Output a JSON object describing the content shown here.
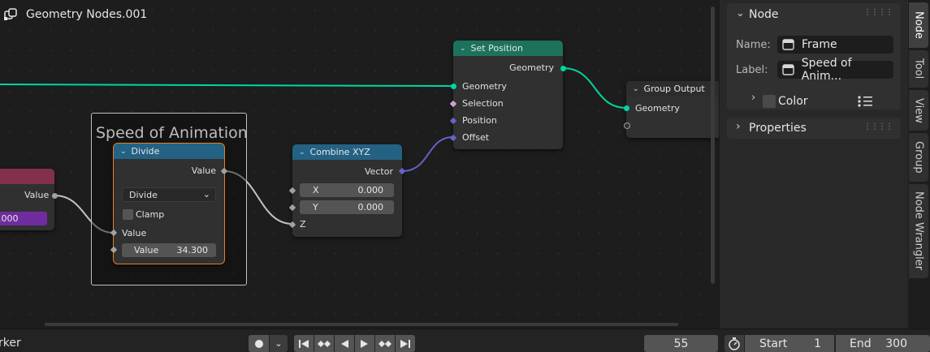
{
  "editor": {
    "title": "Geometry Nodes.001",
    "icon": "node-tree-icon"
  },
  "frame": {
    "label": "Speed of Animation"
  },
  "nodes": {
    "partial": {
      "output_label": "Value",
      "value": ".000"
    },
    "divide": {
      "title": "Divide",
      "output_label": "Value",
      "operation": "Divide",
      "clamp_label": "Clamp",
      "input_label": "Value",
      "value_label": "Value",
      "value": "34.300"
    },
    "combine_xyz": {
      "title": "Combine XYZ",
      "output_label": "Vector",
      "x_label": "X",
      "x_value": "0.000",
      "y_label": "Y",
      "y_value": "0.000",
      "z_label": "Z"
    },
    "set_position": {
      "title": "Set Position",
      "output_label": "Geometry",
      "inputs": [
        "Geometry",
        "Selection",
        "Position",
        "Offset"
      ]
    },
    "group_output": {
      "title": "Group Output",
      "input_label": "Geometry"
    }
  },
  "sidebar": {
    "node_panel_title": "Node",
    "name_label": "Name:",
    "name_value": "Frame",
    "label_label": "Label:",
    "label_value": "Speed of Anim...",
    "color_label": "Color",
    "properties_title": "Properties",
    "tabs": [
      "Node",
      "Tool",
      "View",
      "Group",
      "Node Wrangler"
    ],
    "active_tab": "Node"
  },
  "timeline": {
    "marker_label": "rker",
    "current_frame": "55",
    "start_label": "Start",
    "start_value": "1",
    "end_label": "End",
    "end_value": "300"
  },
  "colors": {
    "geometry_socket": "#00d6a3",
    "vector_socket": "#6363c7",
    "math_header": "#246283",
    "geometry_header": "#1d725e",
    "active_outline": "#e38124",
    "purple_field": "#6f2c9e",
    "input_header": "#83314a"
  }
}
